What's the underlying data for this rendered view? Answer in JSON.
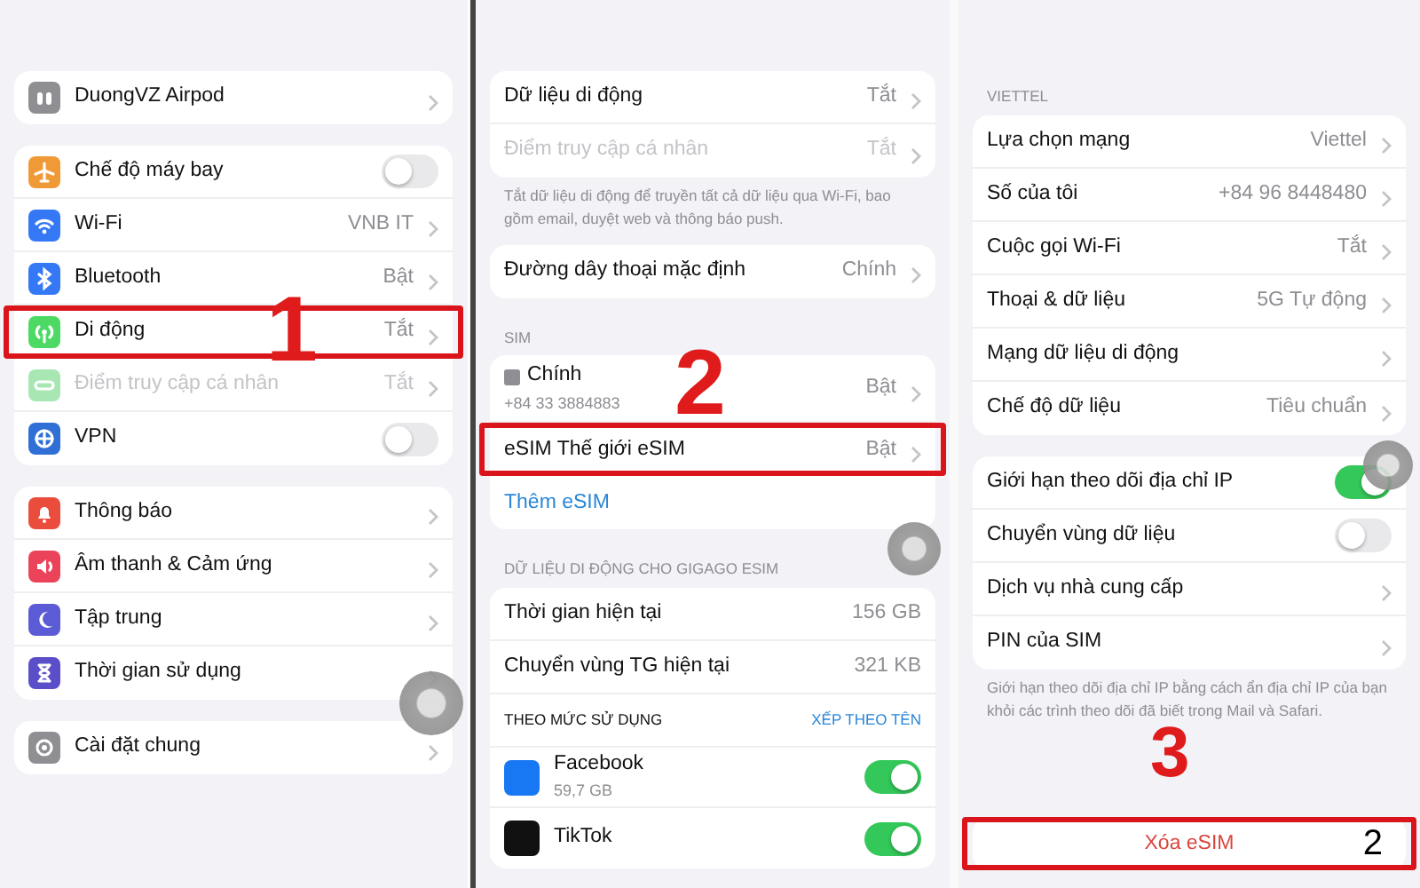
{
  "panels": [
    {
      "step": "1",
      "groups": [
        {
          "rows": [
            {
              "kind": "nav",
              "label": "DuongVZ Airpod",
              "color": "#8e8e93"
            }
          ]
        },
        {
          "rows": [
            {
              "kind": "toggle",
              "label": "Chế độ máy bay",
              "on": false,
              "color": "#f09a37"
            },
            {
              "kind": "nav",
              "label": "Wi-Fi",
              "value": "VNB IT",
              "color": "#3478f6"
            },
            {
              "kind": "nav",
              "label": "Bluetooth",
              "value": "Bật",
              "color": "#3478f6"
            },
            {
              "kind": "nav",
              "label": "Di động",
              "value": "Tắt",
              "color": "#4cd964",
              "highlighted": true
            },
            {
              "kind": "nav",
              "label": "Điểm truy cập cá nhân",
              "value": "Tắt",
              "color": "#a8e6b4",
              "disabled": true
            },
            {
              "kind": "toggle",
              "label": "VPN",
              "on": false,
              "color": "#2f6fd6"
            }
          ]
        },
        {
          "rows": [
            {
              "kind": "nav",
              "label": "Thông báo",
              "color": "#eb4d3d"
            },
            {
              "kind": "nav",
              "label": "Âm thanh & Cảm ứng",
              "color": "#eb445a"
            },
            {
              "kind": "nav",
              "label": "Tập trung",
              "color": "#5b5bd6"
            },
            {
              "kind": "nav",
              "label": "Thời gian sử dụng",
              "color": "#5b4fc9"
            }
          ]
        },
        {
          "rows": [
            {
              "kind": "nav",
              "label": "Cài đặt chung",
              "color": "#8e8e93"
            }
          ]
        }
      ]
    },
    {
      "step": "2",
      "groups": [
        {
          "rows": [
            {
              "kind": "nav",
              "label": "Dữ liệu di động",
              "value": "Tắt"
            },
            {
              "kind": "nav",
              "label": "Điểm truy cập cá nhân",
              "value": "Tắt",
              "disabled": true
            }
          ],
          "footer": "Tắt dữ liệu di động để truyền tất cả dữ liệu qua Wi-Fi, bao gồm email, duyệt web và thông báo push."
        },
        {
          "rows": [
            {
              "kind": "nav",
              "label": "Đường dây thoại mặc định",
              "value": "Chính"
            }
          ]
        },
        {
          "header": "SIM",
          "rows": [
            {
              "kind": "sim",
              "label": "Chính",
              "sublabel": "+84 33 3884883",
              "value": "Bật"
            },
            {
              "kind": "nav",
              "label": "eSIM Thế giới eSIM",
              "value": "Bật",
              "highlighted": true
            },
            {
              "kind": "link",
              "label": "Thêm eSIM"
            }
          ]
        },
        {
          "header": "DỮ LIỆU DI ĐỘNG CHO GIGAGO ESIM",
          "rows": [
            {
              "kind": "stat",
              "label": "Thời gian hiện tại",
              "value": "156 GB"
            },
            {
              "kind": "stat",
              "label": "Chuyển vùng TG hiện tại",
              "value": "321 KB"
            },
            {
              "kind": "sort",
              "label": "THEO MỨC SỬ DỤNG",
              "value": "XẾP THEO TÊN"
            },
            {
              "kind": "app",
              "label": "Facebook",
              "sublabel": "59,7 GB",
              "on": true,
              "color": "#1877f2"
            },
            {
              "kind": "app",
              "label": "TikTok",
              "on": true,
              "color": "#111111"
            }
          ]
        }
      ]
    },
    {
      "step": "3",
      "groups": [
        {
          "header": "VIETTEL",
          "rows": [
            {
              "kind": "nav",
              "label": "Lựa chọn mạng",
              "value": "Viettel"
            },
            {
              "kind": "nav",
              "label": "Số của tôi",
              "value": "+84 96 8448480"
            },
            {
              "kind": "nav",
              "label": "Cuộc gọi Wi-Fi",
              "value": "Tắt"
            },
            {
              "kind": "nav",
              "label": "Thoại & dữ liệu",
              "value": "5G Tự động"
            },
            {
              "kind": "nav",
              "label": "Mạng dữ liệu di động"
            },
            {
              "kind": "nav",
              "label": "Chế độ dữ liệu",
              "value": "Tiêu chuẩn"
            }
          ]
        },
        {
          "rows": [
            {
              "kind": "toggle",
              "label": "Giới hạn theo dõi địa chỉ IP",
              "on": true
            },
            {
              "kind": "toggle",
              "label": "Chuyển vùng dữ liệu",
              "on": false
            },
            {
              "kind": "nav",
              "label": "Dịch vụ nhà cung cấp"
            },
            {
              "kind": "nav",
              "label": "PIN của SIM"
            }
          ],
          "footer": "Giới hạn theo dõi địa chỉ IP bằng cách ẩn địa chỉ IP của bạn khỏi các trình theo dõi đã biết trong Mail và Safari."
        },
        {
          "rows": [
            {
              "kind": "button",
              "label": "Xóa eSIM",
              "highlighted": true,
              "note": "2"
            }
          ]
        }
      ]
    }
  ]
}
